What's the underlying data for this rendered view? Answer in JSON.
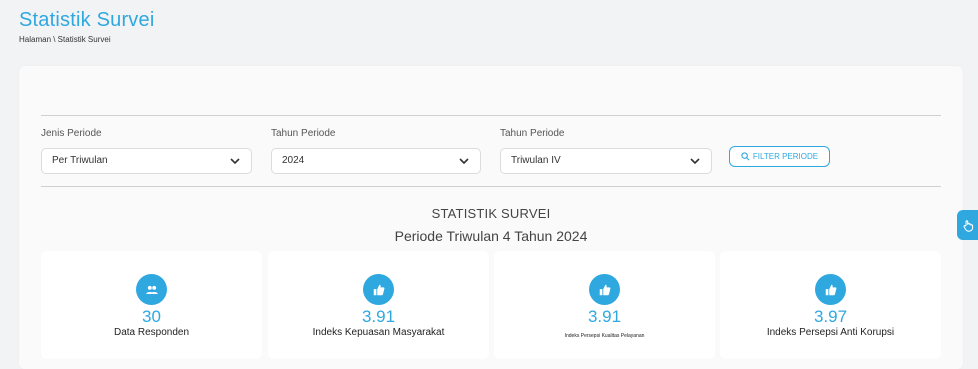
{
  "header": {
    "title": "Statistik Survei",
    "breadcrumb": "Halaman \\ Statistik Survei"
  },
  "filters": {
    "jenis_label": "Jenis Periode",
    "jenis_value": "Per Triwulan",
    "tahun_label": "Tahun Periode",
    "tahun_value": "2024",
    "triwulan_label": "Tahun Periode",
    "triwulan_value": "Triwulan IV",
    "button_label": "FILTER PERIODE"
  },
  "stats": {
    "title": "STATISTIK SURVEI",
    "period": "Periode Triwulan 4 Tahun 2024",
    "tiles": [
      {
        "value": "30",
        "label": "Data Responden",
        "icon": "users-icon"
      },
      {
        "value": "3.91",
        "label": "Indeks Kepuasan Masyarakat",
        "icon": "thumbs-up-icon"
      },
      {
        "value": "3.91",
        "label": "Indeks Persepsi Kualitas Pelayanan",
        "icon": "thumbs-up-icon"
      },
      {
        "value": "3.97",
        "label": "Indeks Persepsi Anti Korupsi",
        "icon": "thumbs-up-icon"
      }
    ]
  },
  "colors": {
    "accent": "#2fa8e0",
    "background": "#f2f3f5"
  }
}
